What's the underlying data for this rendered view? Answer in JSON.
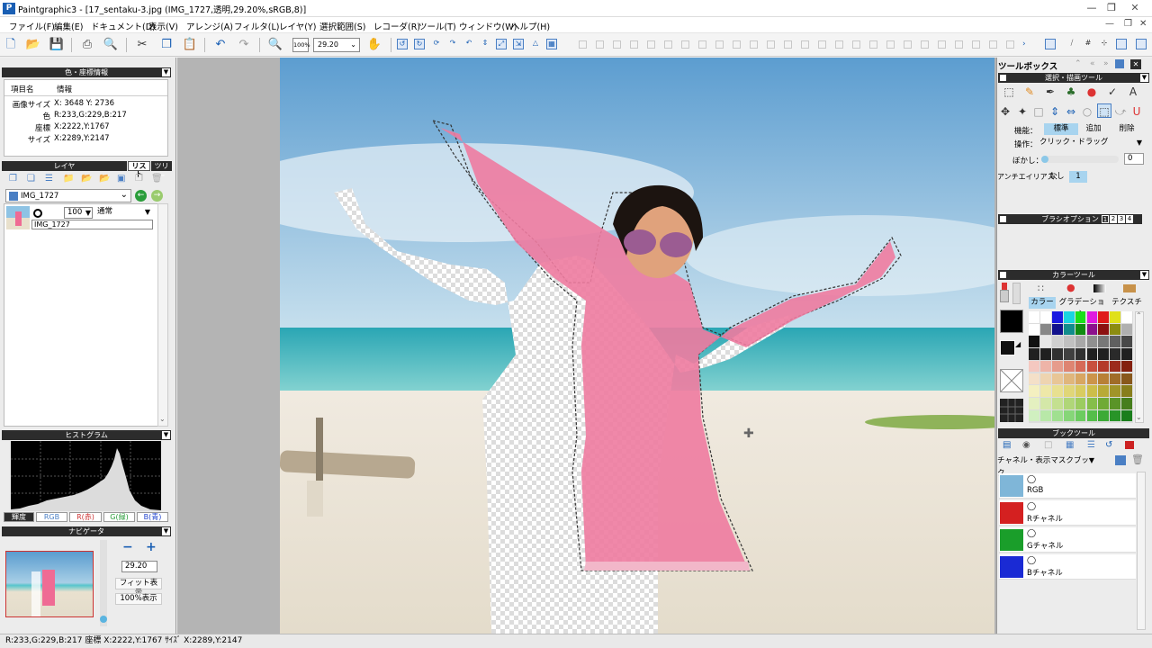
{
  "window": {
    "title": "Paintgraphic3 - [17_sentaku-3.jpg (IMG_1727,透明,29.20%,sRGB,8)]"
  },
  "menu": [
    "ファイル(F)",
    "編集(E)",
    "ドキュメント(D)",
    "表示(V)",
    "アレンジ(A)",
    "フィルタ(L)",
    "レイヤ(Y)",
    "選択範囲(S)",
    "レコーダ(R)",
    "ツール(T)",
    "ウィンドウ(W)",
    "ヘルプ(H)"
  ],
  "toolbar": {
    "zoom_button": "100%",
    "zoom_value": "29.20"
  },
  "color_info": {
    "title": "色・座標情報",
    "col_item": "項目名",
    "col_info": "情報",
    "rows": [
      {
        "label": "画像サイズ",
        "value": "X: 3648  Y: 2736"
      },
      {
        "label": "色",
        "value": "R:233,G:229,B:217"
      },
      {
        "label": "座標",
        "value": "X:2222,Y:1767"
      },
      {
        "label": "サイズ",
        "value": "X:2289,Y:2147"
      }
    ]
  },
  "layer_panel": {
    "title": "レイヤ",
    "tab_list": "リスト",
    "tab_tree": "ツリー",
    "selector": "IMG_1727",
    "opacity": "100",
    "blend": "通常",
    "layer_name": "IMG_1727"
  },
  "histogram": {
    "title": "ヒストグラム",
    "tabs": [
      "輝度",
      "RGB",
      "R(赤)",
      "G(緑)",
      "B(青)"
    ]
  },
  "navigator": {
    "title": "ナビゲータ",
    "minus": "−",
    "plus": "+",
    "zoom": "29.20",
    "fit": "フィット表示",
    "actual": "100%表示"
  },
  "toolbox": {
    "title": "ツールボックス",
    "section": "選択・描画ツール",
    "func_label": "機能：",
    "func_opts": [
      "標準",
      "追加",
      "削除"
    ],
    "op_label": "操作：",
    "op_value": "クリック・ドラッグ",
    "blur_label": "ぼかし：",
    "blur_value": "0",
    "aa_label": "アンチエイリアス：",
    "aa_none": "なし",
    "aa_one": "1"
  },
  "brush_options": {
    "title": "ブラシオプション",
    "pages": [
      "1",
      "2",
      "3",
      "4"
    ]
  },
  "color_tool": {
    "title": "カラーツール",
    "tabs": [
      "カラー",
      "グラデーション",
      "テクスチャ"
    ]
  },
  "book_tool": {
    "title": "ブックツール",
    "selector": "チャネル・表示マスクブック",
    "channels": [
      {
        "name": "RGB",
        "color": "#7fb6d8"
      },
      {
        "name": "Rチャネル",
        "color": "#d42020"
      },
      {
        "name": "Gチャネル",
        "color": "#1a9e2a"
      },
      {
        "name": "Bチャネル",
        "color": "#1a2ad4"
      }
    ]
  },
  "status": "R:233,G:229,B:217  座標 X:2222,Y:1767  ｻｲｽﾞ X:2289,Y:2147"
}
